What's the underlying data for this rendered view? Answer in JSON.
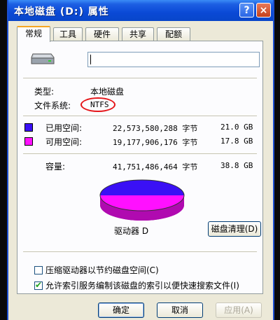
{
  "window": {
    "title": "本地磁盘 (D:) 属性",
    "help_label": "?",
    "close_label": "×"
  },
  "tabs": [
    {
      "label": "常规",
      "active": true
    },
    {
      "label": "工具"
    },
    {
      "label": "硬件"
    },
    {
      "label": "共享"
    },
    {
      "label": "配额"
    }
  ],
  "general": {
    "volume_name_value": "",
    "type_label": "类型:",
    "type_value": "本地磁盘",
    "fs_label": "文件系统:",
    "fs_value": "NTFS",
    "used": {
      "label": "已用空间:",
      "bytes": "22,573,580,288 字节",
      "size": "21.0 GB",
      "color": "#3a10f5"
    },
    "free": {
      "label": "可用空间:",
      "bytes": "19,177,906,176 字节",
      "size": "17.8 GB",
      "color": "#ff10ff"
    },
    "capacity": {
      "label": "容量:",
      "bytes": "41,751,486,464 字节",
      "size": "38.8 GB"
    },
    "drive_label": "驱动器 D",
    "cleanup_label": "磁盘清理(D)",
    "compress_label": "压缩驱动器以节约磁盘空间(C)",
    "compress_checked": false,
    "index_label": "允许索引服务编制该磁盘的索引以便快速搜索文件(I)",
    "index_checked": true,
    "used_fraction": 0.5407
  },
  "buttons": {
    "ok": "确定",
    "cancel": "取消",
    "apply": "应用(A)"
  }
}
